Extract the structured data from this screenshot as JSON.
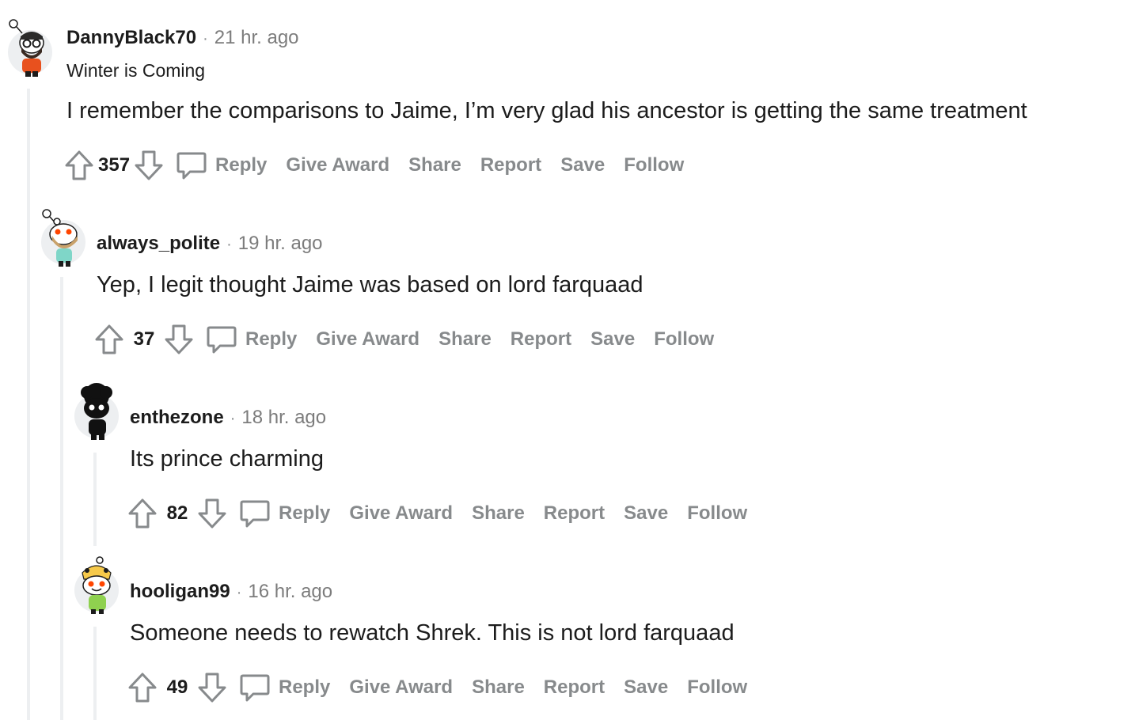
{
  "actions": {
    "reply": "Reply",
    "give_award": "Give Award",
    "share": "Share",
    "report": "Report",
    "save": "Save",
    "follow": "Follow"
  },
  "comments": [
    {
      "username": "DannyBlack70",
      "time": "21 hr. ago",
      "flair": "Winter is Coming",
      "body": "I remember the comparisons to Jaime, I’m very glad his ancestor is getting the same treatment",
      "score": "357",
      "depth": 0
    },
    {
      "username": "always_polite",
      "time": "19 hr. ago",
      "flair": "",
      "body": "Yep, I legit thought Jaime was based on lord farquaad",
      "score": "37",
      "depth": 1
    },
    {
      "username": "enthezone",
      "time": "18 hr. ago",
      "flair": "",
      "body": "Its prince charming",
      "score": "82",
      "depth": 2
    },
    {
      "username": "hooligan99",
      "time": "16 hr. ago",
      "flair": "",
      "body": "Someone needs to rewatch Shrek. This is not lord farquaad",
      "score": "49",
      "depth": 2
    }
  ],
  "colors": {
    "action_gray": "#878a8c",
    "thread_line": "#edeff1",
    "text": "#1c1c1c"
  }
}
